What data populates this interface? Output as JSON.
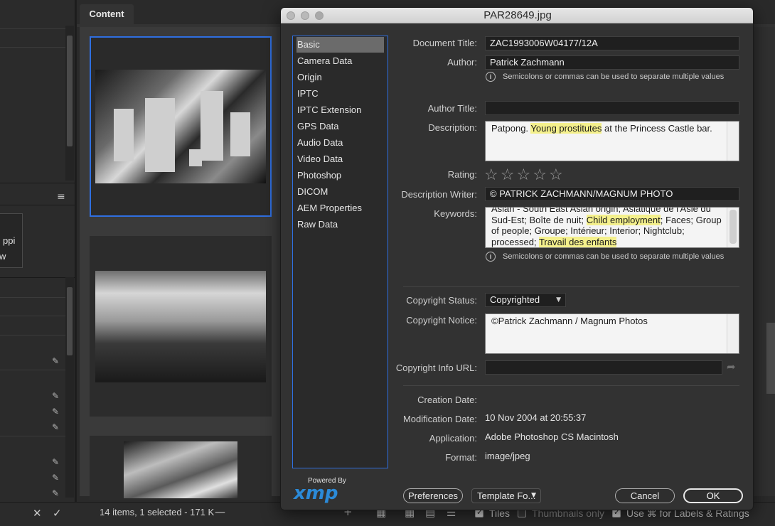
{
  "background": {
    "content_tab": "Content",
    "left_panel": {
      "ppi_text": "ppi",
      "partial_text": "w"
    },
    "status_text": "14 items, 1 selected - 171 K",
    "view_options": [
      {
        "label": "Tiles",
        "checked": true
      },
      {
        "label": "Thumbnails only",
        "checked": false
      },
      {
        "label": "Use ⌘ for Labels & Ratings",
        "checked": true
      }
    ]
  },
  "dialog": {
    "title": "PAR28649.jpg",
    "categories": [
      "Basic",
      "Camera Data",
      "Origin",
      "IPTC",
      "IPTC Extension",
      "GPS Data",
      "Audio Data",
      "Video Data",
      "Photoshop",
      "DICOM",
      "AEM Properties",
      "Raw Data"
    ],
    "selected_category": "Basic",
    "powered_by": "Powered By",
    "xmp_logo": "xmp",
    "labels": {
      "document_title": "Document Title:",
      "author": "Author:",
      "author_title": "Author Title:",
      "description": "Description:",
      "rating": "Rating:",
      "description_writer": "Description Writer:",
      "keywords": "Keywords:",
      "copyright_status": "Copyright Status:",
      "copyright_notice": "Copyright Notice:",
      "copyright_info_url": "Copyright Info URL:",
      "creation_date": "Creation Date:",
      "modification_date": "Modification Date:",
      "application": "Application:",
      "format": "Format:"
    },
    "values": {
      "document_title": "ZAC1993006W04177/12A",
      "author": "Patrick Zachmann",
      "author_title": "",
      "description_prefix": "Patpong. ",
      "description_highlight": "Young prostitutes",
      "description_suffix": " at the Princess Castle bar.",
      "rating": 0,
      "rating_max": 5,
      "description_writer": "© PATRICK ZACHMANN/MAGNUM PHOTO",
      "keywords_part1": "Asian - South East Asian origin; Asiatique de l'Asie du Sud-Est; Boîte de nuit; ",
      "keywords_highlight1": "Child employment",
      "keywords_part2": "; Faces; Group of people; Groupe; Intérieur; Interior; Nightclub; processed; ",
      "keywords_highlight2": "Travail des enfants",
      "copyright_status": "Copyrighted",
      "copyright_notice": "©Patrick Zachmann / Magnum Photos",
      "copyright_info_url": "",
      "creation_date": "",
      "modification_date": "10 Nov 2004 at 20:55:37",
      "application": "Adobe Photoshop CS Macintosh",
      "format": "image/jpeg"
    },
    "info_note": "Semicolons or commas can be used to separate multiple values",
    "buttons": {
      "preferences": "Preferences",
      "template": "Template Fo...",
      "cancel": "Cancel",
      "ok": "OK"
    }
  }
}
